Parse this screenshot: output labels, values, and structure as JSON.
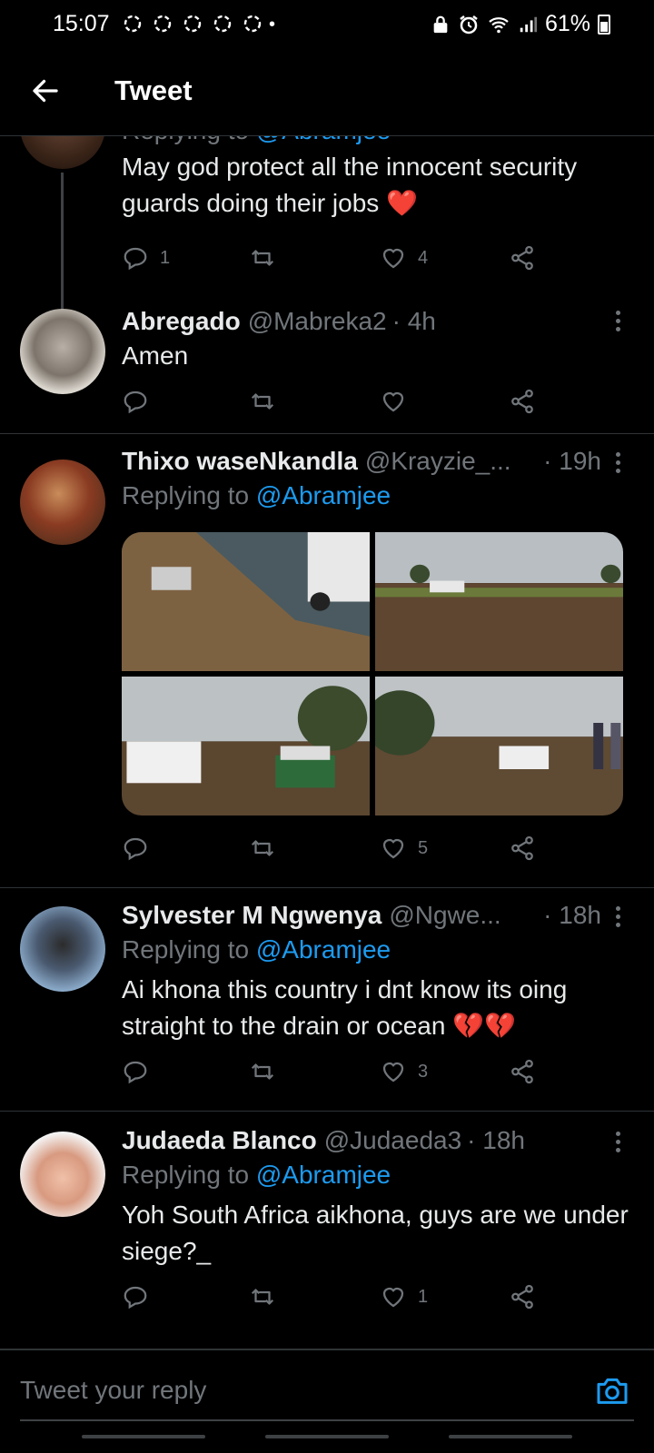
{
  "status_bar": {
    "time": "15:07",
    "battery": "61%"
  },
  "header": {
    "title": "Tweet"
  },
  "tweets": [
    {
      "reply_to_label": "Replying to ",
      "reply_to_handle": "@Abramjee",
      "text": "May god protect all the innocent security guards doing their jobs ❤️",
      "reply_count": "1",
      "retweet_count": "",
      "like_count": "4"
    },
    {
      "name": "Abregado",
      "handle": "@Mabreka2",
      "time": "· 4h",
      "text": "Amen",
      "reply_count": "",
      "retweet_count": "",
      "like_count": ""
    },
    {
      "name": "Thixo waseNkandla",
      "handle": "@Krayzie_...",
      "time": "· 19h",
      "reply_to_label": "Replying to ",
      "reply_to_handle": "@Abramjee",
      "reply_count": "",
      "retweet_count": "",
      "like_count": "5"
    },
    {
      "name": "Sylvester M Ngwenya",
      "handle": "@Ngwe...",
      "time": "· 18h",
      "reply_to_label": "Replying to ",
      "reply_to_handle": "@Abramjee",
      "text": "Ai khona this country i dnt know its oing straight to the drain or ocean 💔💔",
      "reply_count": "",
      "retweet_count": "",
      "like_count": "3"
    },
    {
      "name": "Judaeda Blanco",
      "handle": "@Judaeda3",
      "time": "· 18h",
      "reply_to_label": "Replying to ",
      "reply_to_handle": "@Abramjee",
      "text": "Yoh South Africa aikhona, guys are we under siege?_",
      "reply_count": "",
      "retweet_count": "",
      "like_count": "1"
    }
  ],
  "composer": {
    "placeholder": "Tweet your reply"
  },
  "colors": {
    "accent": "#1d9bf0",
    "muted": "#71767b",
    "background": "#000000",
    "heart": "#f91880"
  }
}
